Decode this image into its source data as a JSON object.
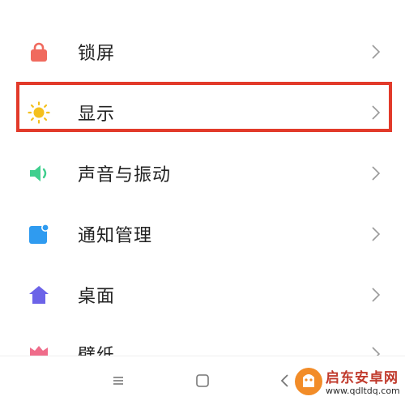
{
  "settings": {
    "items": [
      {
        "label": "锁屏",
        "icon": "lock-icon",
        "color": "#f06a5e"
      },
      {
        "label": "显示",
        "icon": "sun-icon",
        "color": "#f4c01e"
      },
      {
        "label": "声音与振动",
        "icon": "speaker-icon",
        "color": "#3fcf8e"
      },
      {
        "label": "通知管理",
        "icon": "notification-icon",
        "color": "#2f9bf0"
      },
      {
        "label": "桌面",
        "icon": "home-icon",
        "color": "#6c63e8"
      },
      {
        "label": "壁纸",
        "icon": "wallpaper-icon",
        "color": "#ef6c8a"
      }
    ],
    "chevron_icon": "chevron-right-icon"
  },
  "highlight": {
    "color": "#e23a2a",
    "target": "显示"
  },
  "navbar": {
    "menu_icon": "menu-icon",
    "home_icon": "square-home-icon",
    "back_icon": "back-icon"
  },
  "watermark": {
    "title": "启东安卓网",
    "url": "www.qdltdq.com"
  }
}
